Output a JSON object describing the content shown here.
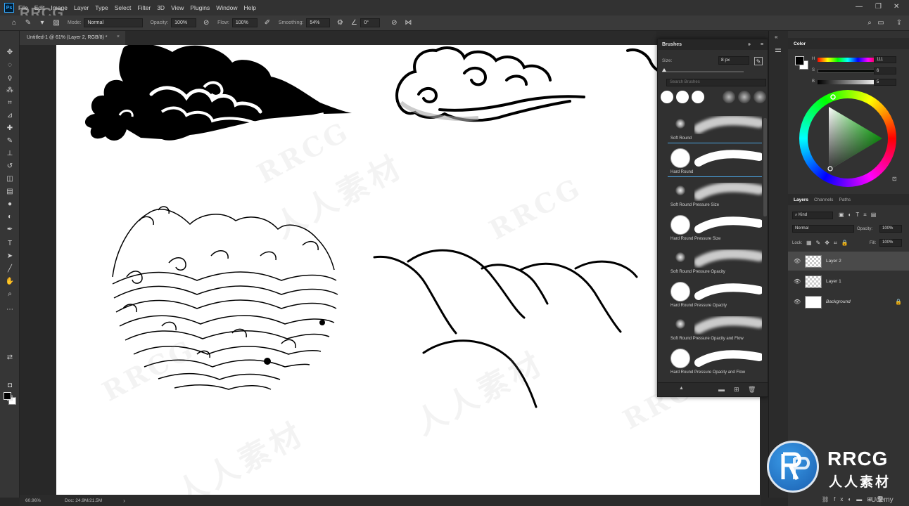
{
  "app": {
    "logo": "Ps",
    "watermark_top": "RRCG",
    "menu": [
      "File",
      "Edit",
      "Image",
      "Layer",
      "Type",
      "Select",
      "Filter",
      "3D",
      "View",
      "Plugins",
      "Window",
      "Help"
    ]
  },
  "options_bar": {
    "mode_label": "Mode:",
    "mode_value": "Normal",
    "opacity_label": "Opacity:",
    "opacity_value": "100%",
    "flow_label": "Flow:",
    "flow_value": "100%",
    "smoothing_label": "Smoothing:",
    "smoothing_value": "54%",
    "angle_value": "0°"
  },
  "document": {
    "tab_title": "Untitled-1 @ 61% (Layer 2, RGB/8) *",
    "zoom": "60.96%",
    "doc_info": "Doc: 24.9M/21.5M"
  },
  "brushes_panel": {
    "title": "Brushes",
    "size_label": "Size:",
    "size_value": "8 px",
    "search_placeholder": "Search Brushes",
    "brushes": [
      {
        "name": "Soft Round",
        "tip": "soft",
        "selected": false
      },
      {
        "name": "Hard Round",
        "tip": "hard",
        "selected": true
      },
      {
        "name": "Soft Round Pressure Size",
        "tip": "soft",
        "selected": false
      },
      {
        "name": "Hard Round Pressure Size",
        "tip": "hard",
        "selected": false
      },
      {
        "name": "Soft Round Pressure Opacity",
        "tip": "soft",
        "selected": false
      },
      {
        "name": "Hard Round Pressure Opacity",
        "tip": "hard",
        "selected": false
      },
      {
        "name": "Soft Round Pressure Opacity and Flow",
        "tip": "soft",
        "selected": false
      },
      {
        "name": "Hard Round Pressure Opacity and Flow",
        "tip": "hard",
        "selected": false
      }
    ]
  },
  "color_panel": {
    "title": "Color",
    "h_label": "H",
    "s_label": "S",
    "b_label": "B",
    "h_value": "111",
    "s_value": "6",
    "b_value": "5"
  },
  "layers_panel": {
    "tabs": [
      "Layers",
      "Channels",
      "Paths"
    ],
    "filter_kind": "Kind",
    "blend_mode": "Normal",
    "opacity_label": "Opacity:",
    "opacity_value": "100%",
    "lock_label": "Lock:",
    "fill_label": "Fill:",
    "fill_value": "100%",
    "layers": [
      {
        "name": "Layer 2",
        "selected": true,
        "thumb": "checker"
      },
      {
        "name": "Layer 1",
        "selected": false,
        "thumb": "checker"
      },
      {
        "name": "Background",
        "selected": false,
        "thumb": "white",
        "locked": true
      }
    ]
  },
  "watermark": {
    "brand": "RRCG",
    "brand_cn": "人人素材",
    "footer": "Udemy"
  },
  "colors": {
    "accent": "#31a8ff",
    "selection": "#4aa3e0",
    "logo_blue": "#1a5fb0"
  }
}
